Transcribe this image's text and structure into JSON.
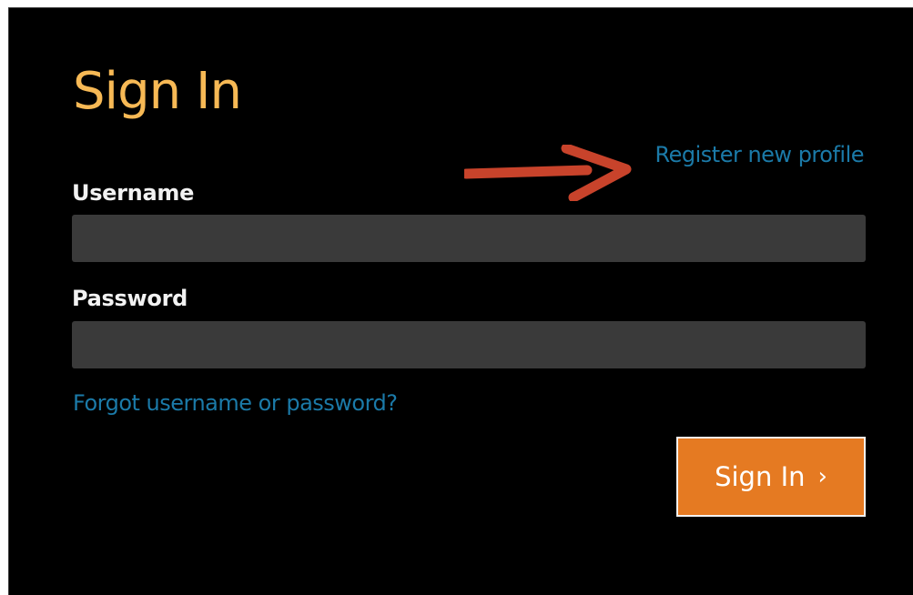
{
  "form": {
    "title": "Sign In",
    "register_link": "Register new profile",
    "username_label": "Username",
    "username_value": "",
    "password_label": "Password",
    "password_value": "",
    "forgot_link": "Forgot username or password?",
    "submit_label": "Sign In",
    "submit_icon": "chevron-right-icon",
    "submit_glyph": "›"
  },
  "annotation": {
    "arrow_icon": "arrow-right-icon",
    "arrow_color": "#c8432b"
  },
  "colors": {
    "background": "#000000",
    "title": "#f7b955",
    "link": "#1b7aa8",
    "input_bg": "#3a3a3a",
    "button": "#e57a22",
    "label": "#f2f2f2"
  }
}
